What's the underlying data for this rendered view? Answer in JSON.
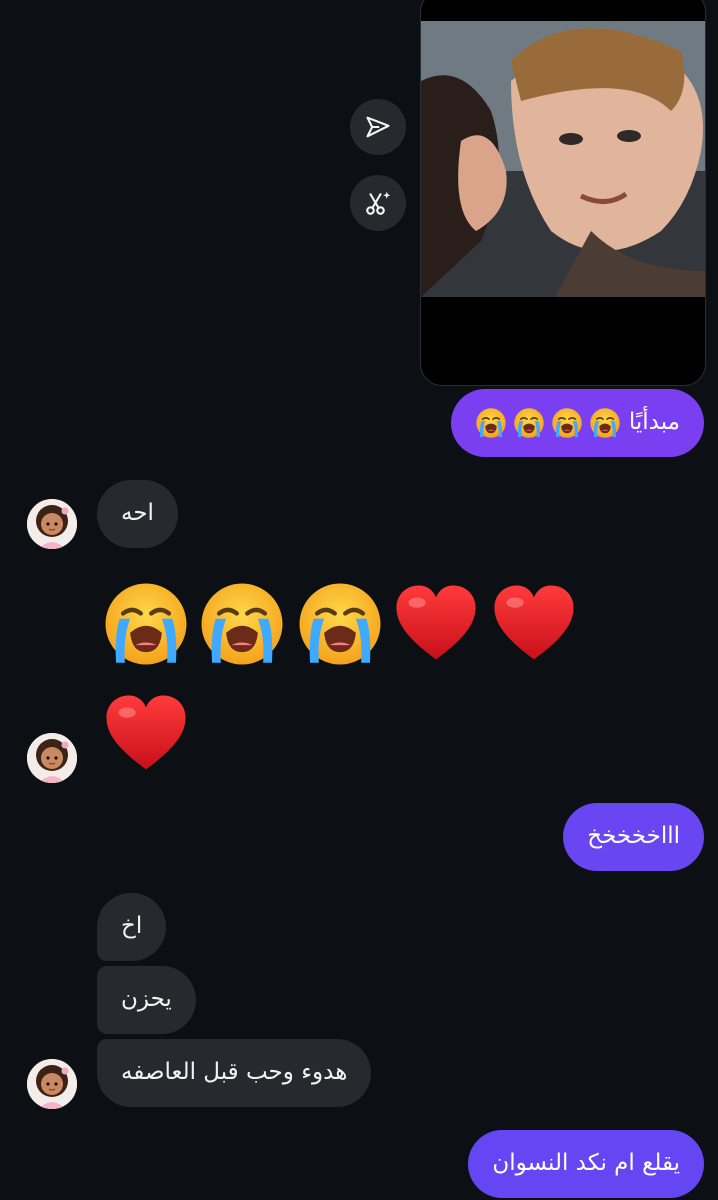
{
  "colors": {
    "background": "#0c1014",
    "sent_bubble_purple": "#7a3ff0",
    "sent_bubble_violet": "#6447f2",
    "received_bubble": "#262a2f",
    "action_button": "#262a2f"
  },
  "media": {
    "actions": [
      {
        "icon": "send-icon"
      },
      {
        "icon": "scissors-sparkle-icon"
      }
    ]
  },
  "messages": {
    "sent_1": "مبدأيًا",
    "recv_1": "احه",
    "sent_2": "اااخخخخخ",
    "recv_2": "اخ",
    "recv_3": "يحزن",
    "recv_4": "هدوء وحب قبل العاصفه",
    "sent_3": "يقلع ام نكد النسوان"
  },
  "emoji_row": [
    "crying-face",
    "crying-face",
    "crying-face",
    "red-heart",
    "red-heart"
  ],
  "emoji_row_2": [
    "red-heart"
  ],
  "sent_1_emojis": [
    "crying-face",
    "crying-face",
    "crying-face",
    "crying-face"
  ]
}
